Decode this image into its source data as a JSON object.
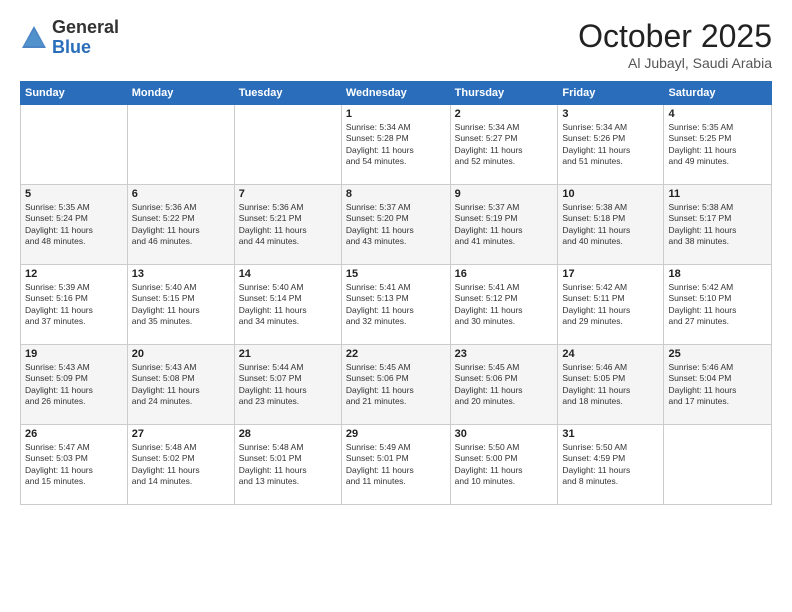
{
  "header": {
    "logo_general": "General",
    "logo_blue": "Blue",
    "month_title": "October 2025",
    "location": "Al Jubayl, Saudi Arabia"
  },
  "days_of_week": [
    "Sunday",
    "Monday",
    "Tuesday",
    "Wednesday",
    "Thursday",
    "Friday",
    "Saturday"
  ],
  "weeks": [
    [
      {
        "day": "",
        "info": ""
      },
      {
        "day": "",
        "info": ""
      },
      {
        "day": "",
        "info": ""
      },
      {
        "day": "1",
        "info": "Sunrise: 5:34 AM\nSunset: 5:28 PM\nDaylight: 11 hours\nand 54 minutes."
      },
      {
        "day": "2",
        "info": "Sunrise: 5:34 AM\nSunset: 5:27 PM\nDaylight: 11 hours\nand 52 minutes."
      },
      {
        "day": "3",
        "info": "Sunrise: 5:34 AM\nSunset: 5:26 PM\nDaylight: 11 hours\nand 51 minutes."
      },
      {
        "day": "4",
        "info": "Sunrise: 5:35 AM\nSunset: 5:25 PM\nDaylight: 11 hours\nand 49 minutes."
      }
    ],
    [
      {
        "day": "5",
        "info": "Sunrise: 5:35 AM\nSunset: 5:24 PM\nDaylight: 11 hours\nand 48 minutes."
      },
      {
        "day": "6",
        "info": "Sunrise: 5:36 AM\nSunset: 5:22 PM\nDaylight: 11 hours\nand 46 minutes."
      },
      {
        "day": "7",
        "info": "Sunrise: 5:36 AM\nSunset: 5:21 PM\nDaylight: 11 hours\nand 44 minutes."
      },
      {
        "day": "8",
        "info": "Sunrise: 5:37 AM\nSunset: 5:20 PM\nDaylight: 11 hours\nand 43 minutes."
      },
      {
        "day": "9",
        "info": "Sunrise: 5:37 AM\nSunset: 5:19 PM\nDaylight: 11 hours\nand 41 minutes."
      },
      {
        "day": "10",
        "info": "Sunrise: 5:38 AM\nSunset: 5:18 PM\nDaylight: 11 hours\nand 40 minutes."
      },
      {
        "day": "11",
        "info": "Sunrise: 5:38 AM\nSunset: 5:17 PM\nDaylight: 11 hours\nand 38 minutes."
      }
    ],
    [
      {
        "day": "12",
        "info": "Sunrise: 5:39 AM\nSunset: 5:16 PM\nDaylight: 11 hours\nand 37 minutes."
      },
      {
        "day": "13",
        "info": "Sunrise: 5:40 AM\nSunset: 5:15 PM\nDaylight: 11 hours\nand 35 minutes."
      },
      {
        "day": "14",
        "info": "Sunrise: 5:40 AM\nSunset: 5:14 PM\nDaylight: 11 hours\nand 34 minutes."
      },
      {
        "day": "15",
        "info": "Sunrise: 5:41 AM\nSunset: 5:13 PM\nDaylight: 11 hours\nand 32 minutes."
      },
      {
        "day": "16",
        "info": "Sunrise: 5:41 AM\nSunset: 5:12 PM\nDaylight: 11 hours\nand 30 minutes."
      },
      {
        "day": "17",
        "info": "Sunrise: 5:42 AM\nSunset: 5:11 PM\nDaylight: 11 hours\nand 29 minutes."
      },
      {
        "day": "18",
        "info": "Sunrise: 5:42 AM\nSunset: 5:10 PM\nDaylight: 11 hours\nand 27 minutes."
      }
    ],
    [
      {
        "day": "19",
        "info": "Sunrise: 5:43 AM\nSunset: 5:09 PM\nDaylight: 11 hours\nand 26 minutes."
      },
      {
        "day": "20",
        "info": "Sunrise: 5:43 AM\nSunset: 5:08 PM\nDaylight: 11 hours\nand 24 minutes."
      },
      {
        "day": "21",
        "info": "Sunrise: 5:44 AM\nSunset: 5:07 PM\nDaylight: 11 hours\nand 23 minutes."
      },
      {
        "day": "22",
        "info": "Sunrise: 5:45 AM\nSunset: 5:06 PM\nDaylight: 11 hours\nand 21 minutes."
      },
      {
        "day": "23",
        "info": "Sunrise: 5:45 AM\nSunset: 5:06 PM\nDaylight: 11 hours\nand 20 minutes."
      },
      {
        "day": "24",
        "info": "Sunrise: 5:46 AM\nSunset: 5:05 PM\nDaylight: 11 hours\nand 18 minutes."
      },
      {
        "day": "25",
        "info": "Sunrise: 5:46 AM\nSunset: 5:04 PM\nDaylight: 11 hours\nand 17 minutes."
      }
    ],
    [
      {
        "day": "26",
        "info": "Sunrise: 5:47 AM\nSunset: 5:03 PM\nDaylight: 11 hours\nand 15 minutes."
      },
      {
        "day": "27",
        "info": "Sunrise: 5:48 AM\nSunset: 5:02 PM\nDaylight: 11 hours\nand 14 minutes."
      },
      {
        "day": "28",
        "info": "Sunrise: 5:48 AM\nSunset: 5:01 PM\nDaylight: 11 hours\nand 13 minutes."
      },
      {
        "day": "29",
        "info": "Sunrise: 5:49 AM\nSunset: 5:01 PM\nDaylight: 11 hours\nand 11 minutes."
      },
      {
        "day": "30",
        "info": "Sunrise: 5:50 AM\nSunset: 5:00 PM\nDaylight: 11 hours\nand 10 minutes."
      },
      {
        "day": "31",
        "info": "Sunrise: 5:50 AM\nSunset: 4:59 PM\nDaylight: 11 hours\nand 8 minutes."
      },
      {
        "day": "",
        "info": ""
      }
    ]
  ]
}
